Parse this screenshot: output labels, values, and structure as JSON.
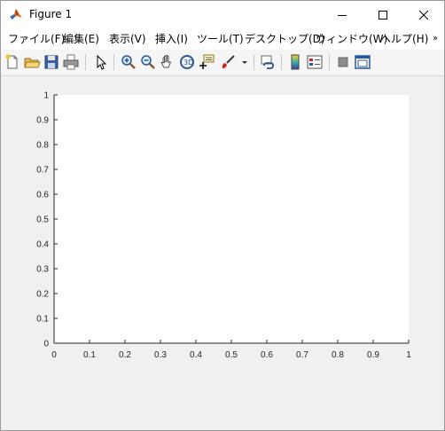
{
  "window": {
    "title": "Figure 1"
  },
  "menu": {
    "items": [
      {
        "label": "ファイル(F)"
      },
      {
        "label": "編集(E)"
      },
      {
        "label": "表示(V)"
      },
      {
        "label": "挿入(I)"
      },
      {
        "label": "ツール(T)"
      },
      {
        "label": "デスクトップ(D)"
      },
      {
        "label": "ウィンドウ(W)"
      },
      {
        "label": "ヘルプ(H)"
      }
    ],
    "more_glyph": "»"
  },
  "toolbar": {
    "icons": [
      "new-figure-icon",
      "open-file-icon",
      "save-icon",
      "print-icon",
      "pointer-icon",
      "zoom-in-icon",
      "zoom-out-icon",
      "pan-icon",
      "rotate-3d-icon",
      "data-cursor-icon",
      "brush-icon",
      "link-plot-icon",
      "colorbar-icon",
      "legend-icon",
      "hide-plot-tools-icon",
      "show-plot-tools-icon"
    ]
  },
  "chart_data": {
    "type": "line",
    "series": [],
    "xlim": [
      0,
      1
    ],
    "ylim": [
      0,
      1
    ],
    "x_ticks": [
      "0",
      "0.1",
      "0.2",
      "0.3",
      "0.4",
      "0.5",
      "0.6",
      "0.7",
      "0.8",
      "0.9",
      "1"
    ],
    "y_ticks": [
      "0",
      "0.1",
      "0.2",
      "0.3",
      "0.4",
      "0.5",
      "0.6",
      "0.7",
      "0.8",
      "0.9",
      "1"
    ],
    "grid": false,
    "title": "",
    "xlabel": "",
    "ylabel": ""
  },
  "colors": {
    "axes_bg": "#ffffff",
    "figure_bg": "#f0f0f0",
    "axis": "#262626"
  }
}
